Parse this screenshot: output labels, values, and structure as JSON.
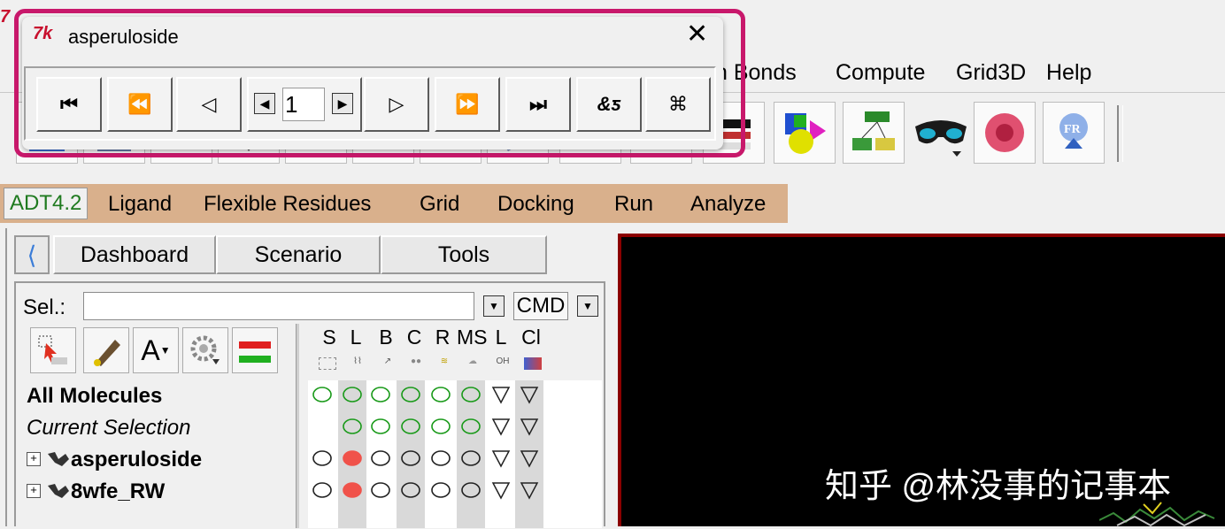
{
  "player": {
    "title": "asperuloside",
    "close_glyph": "✕",
    "frame_value": "1",
    "buttons": [
      {
        "name": "first-frame-button",
        "glyph": "⏮"
      },
      {
        "name": "fast-back-button",
        "glyph": "⏪"
      },
      {
        "name": "play-back-button",
        "glyph": "◁"
      },
      {
        "name": "play-forward-button",
        "glyph": "▷"
      },
      {
        "name": "fast-forward-button",
        "glyph": "⏩"
      },
      {
        "name": "last-frame-button",
        "glyph": "⏭"
      },
      {
        "name": "loop-mode-button",
        "glyph": "&ƽ"
      },
      {
        "name": "settings-button",
        "glyph": "⌘"
      }
    ]
  },
  "menubar": {
    "items": [
      "n Bonds",
      "Compute",
      "Grid3D",
      "Help"
    ]
  },
  "adt_menu": {
    "items": [
      "ADT4.2",
      "Ligand",
      "Flexible Residues",
      "Grid",
      "Docking",
      "Run",
      "Analyze"
    ]
  },
  "dashboard": {
    "tabs": [
      "Dashboard",
      "Scenario",
      "Tools"
    ],
    "sel_label": "Sel.:",
    "sel_value": "",
    "cmd_label": "CMD",
    "columns": [
      {
        "label": "S",
        "icon": "selection-icon"
      },
      {
        "label": "L",
        "icon": "lines-icon"
      },
      {
        "label": "B",
        "icon": "bonds-icon"
      },
      {
        "label": "C",
        "icon": "cpk-icon"
      },
      {
        "label": "R",
        "icon": "ribbon-icon"
      },
      {
        "label": "MS",
        "icon": "surface-icon"
      },
      {
        "label": "L",
        "icon": "label-icon",
        "sub": "OH"
      },
      {
        "label": "Cl",
        "icon": "color-icon"
      }
    ],
    "tree": [
      {
        "label": "All Molecules",
        "style": "bold",
        "expander": false
      },
      {
        "label": "Current Selection",
        "style": "italic",
        "expander": false
      },
      {
        "label": "asperuloside",
        "style": "bold",
        "expander": true
      },
      {
        "label": "8wfe_RW",
        "style": "bold",
        "expander": true
      }
    ],
    "row_states": [
      [
        "circle-green",
        "circle-green",
        "circle-green",
        "circle-green",
        "circle-green",
        "circle-green",
        "triangle",
        "triangle"
      ],
      [
        "none",
        "circle-green",
        "circle-green",
        "circle-green",
        "circle-green",
        "circle-green",
        "triangle",
        "triangle"
      ],
      [
        "circle",
        "dot-red",
        "circle",
        "circle",
        "circle",
        "circle",
        "triangle",
        "triangle"
      ],
      [
        "circle",
        "dot-red",
        "circle",
        "circle",
        "circle",
        "circle",
        "triangle",
        "triangle"
      ]
    ]
  },
  "viewer": {
    "watermark": "知乎 @林没事的记事本"
  },
  "colors": {
    "highlight": "#c8186b",
    "adt_menu_bg": "#d9b08c",
    "viewer_border": "#8b0000",
    "active_green": "#1a9a1a",
    "red_dot": "#f0524a"
  }
}
